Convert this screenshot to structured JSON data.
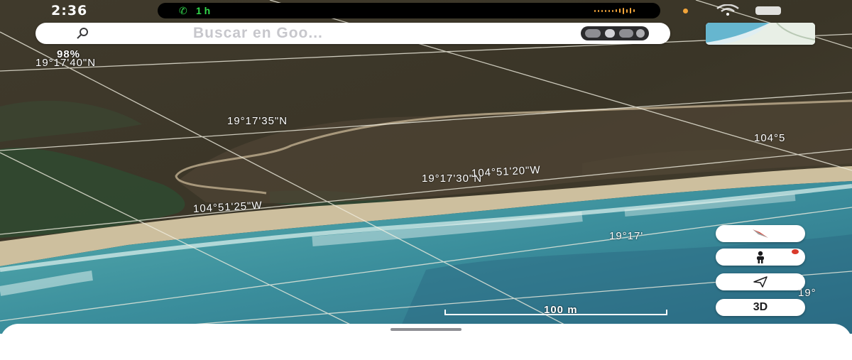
{
  "status_bar": {
    "time": "2:36",
    "call_duration": "1 h"
  },
  "search": {
    "placeholder": "Buscar en Goo..."
  },
  "map": {
    "type": "satellite",
    "zoom_label": "98%",
    "gridline_color": "#f0eee0",
    "coordinates": {
      "lat_40": "19°17'40\"N",
      "lat_35": "19°17'35\"N",
      "lat_30": "19°17'30\"N",
      "lat_partial": "19°17'",
      "lat_edge": "19°",
      "lon_20": "104°51'20\"W",
      "lon_25": "104°51'25\"W",
      "lon_edge": "104°5"
    },
    "scale_label": "100 m"
  },
  "controls": {
    "compass_icon": "compass-icon",
    "pegman_icon": "pegman-icon",
    "location_icon": "location-arrow-icon",
    "view_3d_label": "3D"
  },
  "colors": {
    "call_green": "#32d74b",
    "accent_orange": "#f2a43a",
    "compass_red": "#d93a2b"
  }
}
